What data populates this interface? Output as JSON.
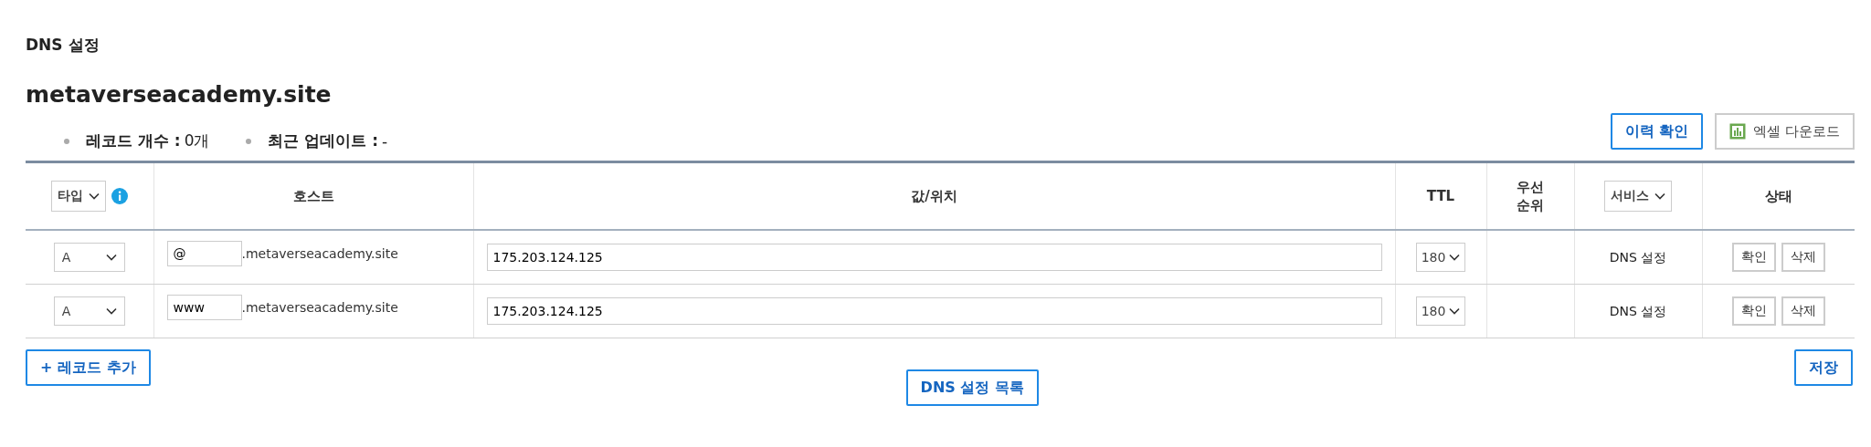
{
  "page_title": "DNS 설정",
  "domain": "metaverseacademy.site",
  "summary": [
    {
      "label": "레코드 개수 :",
      "value": "0개"
    },
    {
      "label": "최근 업데이트 :",
      "value": "-"
    }
  ],
  "actions": [
    {
      "label": "이력 확인",
      "kind": "primary"
    },
    {
      "label": "엑셀 다운로드",
      "kind": "excel"
    }
  ],
  "table": {
    "columns": [
      {
        "kind": "select",
        "label": "타입",
        "info": true
      },
      {
        "kind": "text",
        "label": "호스트"
      },
      {
        "kind": "text",
        "label": "값/위치"
      },
      {
        "kind": "text",
        "label": "TTL"
      },
      {
        "kind": "text",
        "label": "우선\n순위"
      },
      {
        "kind": "select",
        "label": "서비스",
        "info": false
      },
      {
        "kind": "text",
        "label": "상태"
      }
    ],
    "rows": [
      {
        "type": "A",
        "host": "@",
        "suffix": ".metaverseacademy.site",
        "value": "175.203.124.125",
        "ttl": "180",
        "service": "DNS 설정",
        "buttons": [
          "확인",
          "삭제"
        ]
      },
      {
        "type": "A",
        "host": "www",
        "suffix": ".metaverseacademy.site",
        "value": "175.203.124.125",
        "ttl": "180",
        "service": "DNS 설정",
        "buttons": [
          "확인",
          "삭제"
        ]
      }
    ]
  },
  "footer": {
    "add": "+ 레코드 추가",
    "list": "DNS 설정 목록",
    "save": "저장"
  }
}
